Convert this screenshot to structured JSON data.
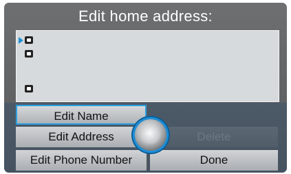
{
  "header": {
    "title": "Edit home address:"
  },
  "address_card": {
    "icons": [
      "cursor-arrow-icon",
      "contact-card-icon",
      "home-icon",
      "phone-icon"
    ]
  },
  "menu": {
    "edit_name": "Edit Name",
    "edit_address": "Edit Address",
    "edit_phone": "Edit Phone Number",
    "delete": "Delete",
    "done": "Done"
  },
  "colors": {
    "accent": "#2aa0e0",
    "screen_bg": "#5f6163",
    "menu_bg": "#4c5a68",
    "card_bg": "#d7dadd"
  }
}
